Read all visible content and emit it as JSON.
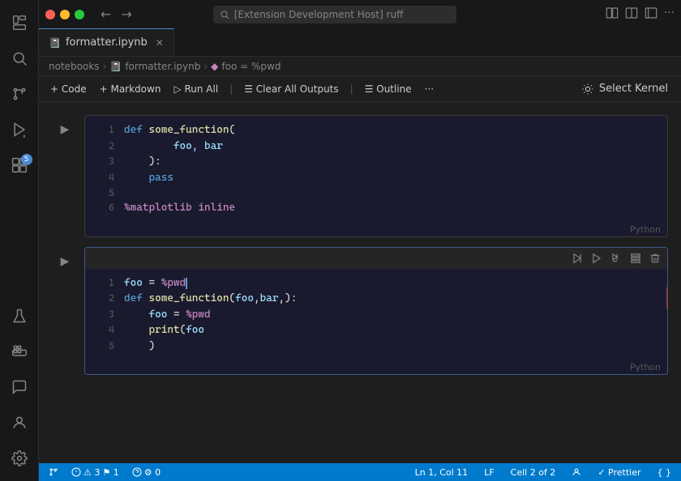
{
  "window": {
    "title": "[Extension Development Host] ruff"
  },
  "activityBar": {
    "icons": [
      {
        "name": "explorer-icon",
        "symbol": "⎘",
        "active": false
      },
      {
        "name": "search-icon",
        "symbol": "🔍",
        "active": false
      },
      {
        "name": "source-control-icon",
        "symbol": "⑂",
        "active": false
      },
      {
        "name": "run-debug-icon",
        "symbol": "▶",
        "active": false
      },
      {
        "name": "extensions-icon",
        "symbol": "⊞",
        "active": false,
        "badge": "5"
      }
    ],
    "bottomIcons": [
      {
        "name": "flask-icon",
        "symbol": "⚗",
        "active": false
      },
      {
        "name": "docker-icon",
        "symbol": "🐳",
        "active": false
      },
      {
        "name": "chat-icon",
        "symbol": "💬",
        "active": false
      },
      {
        "name": "account-icon",
        "symbol": "👤",
        "active": false
      },
      {
        "name": "settings-icon",
        "symbol": "⚙",
        "active": false
      }
    ]
  },
  "tabs": [
    {
      "label": "formatter.ipynb",
      "icon": "📓",
      "active": true,
      "closeable": true
    }
  ],
  "breadcrumb": {
    "items": [
      "notebooks",
      "formatter.ipynb",
      "foo = %pwd"
    ]
  },
  "toolbar": {
    "code_label": "+ Code",
    "markdown_label": "+ Markdown",
    "run_all_label": "▷ Run All",
    "clear_outputs_label": "☰ Clear All Outputs",
    "outline_label": "☰ Outline",
    "more_label": "···",
    "select_kernel_label": "Select Kernel"
  },
  "cells": [
    {
      "id": "cell-1",
      "lines": [
        {
          "num": "1",
          "tokens": [
            {
              "type": "kw",
              "text": "def "
            },
            {
              "type": "fn",
              "text": "some_function"
            },
            {
              "type": "op",
              "text": "("
            }
          ]
        },
        {
          "num": "2",
          "tokens": [
            {
              "type": "param",
              "text": "        foo, bar"
            }
          ]
        },
        {
          "num": "3",
          "tokens": [
            {
              "type": "op",
              "text": "    ):"
            }
          ]
        },
        {
          "num": "4",
          "tokens": [
            {
              "type": "kw",
              "text": "    pass"
            }
          ]
        },
        {
          "num": "5",
          "tokens": []
        },
        {
          "num": "6",
          "tokens": [
            {
              "type": "magic",
              "text": "%matplotlib inline"
            }
          ]
        }
      ],
      "language": "Python",
      "active": false
    },
    {
      "id": "cell-2",
      "lines": [
        {
          "num": "1",
          "tokens": [
            {
              "type": "param",
              "text": "foo"
            },
            {
              "type": "op",
              "text": " = "
            },
            {
              "type": "magic",
              "text": "%pwd"
            },
            {
              "type": "cursor",
              "text": ""
            }
          ]
        },
        {
          "num": "2",
          "tokens": [
            {
              "type": "kw",
              "text": "def "
            },
            {
              "type": "fn",
              "text": "some_function"
            },
            {
              "type": "op",
              "text": "("
            },
            {
              "type": "param",
              "text": "foo"
            },
            {
              "type": "op",
              "text": ","
            },
            {
              "type": "param",
              "text": "bar"
            },
            {
              "type": "op",
              "text": ",):"
            }
          ]
        },
        {
          "num": "3",
          "tokens": [
            {
              "type": "op",
              "text": "    "
            },
            {
              "type": "param",
              "text": "foo"
            },
            {
              "type": "op",
              "text": " = "
            },
            {
              "type": "magic",
              "text": "%pwd"
            }
          ]
        },
        {
          "num": "4",
          "tokens": [
            {
              "type": "op",
              "text": "    "
            },
            {
              "type": "fn",
              "text": "print"
            },
            {
              "type": "op",
              "text": "("
            },
            {
              "type": "param",
              "text": "foo"
            }
          ]
        },
        {
          "num": "5",
          "tokens": [
            {
              "type": "op",
              "text": "    )"
            }
          ]
        }
      ],
      "language": "Python",
      "active": true
    }
  ],
  "statusBar": {
    "left": [
      {
        "icon": "⚡",
        "text": "⚠ 3  ⚑ 1"
      },
      {
        "icon": "",
        "text": "⚙ 0"
      }
    ],
    "right": [
      {
        "text": "Ln 1, Col 11"
      },
      {
        "text": "LF"
      },
      {
        "text": "Cell 2 of 2"
      },
      {
        "icon": "👤",
        "text": ""
      },
      {
        "text": "✓ Prettier"
      },
      {
        "text": "{ }"
      }
    ]
  }
}
